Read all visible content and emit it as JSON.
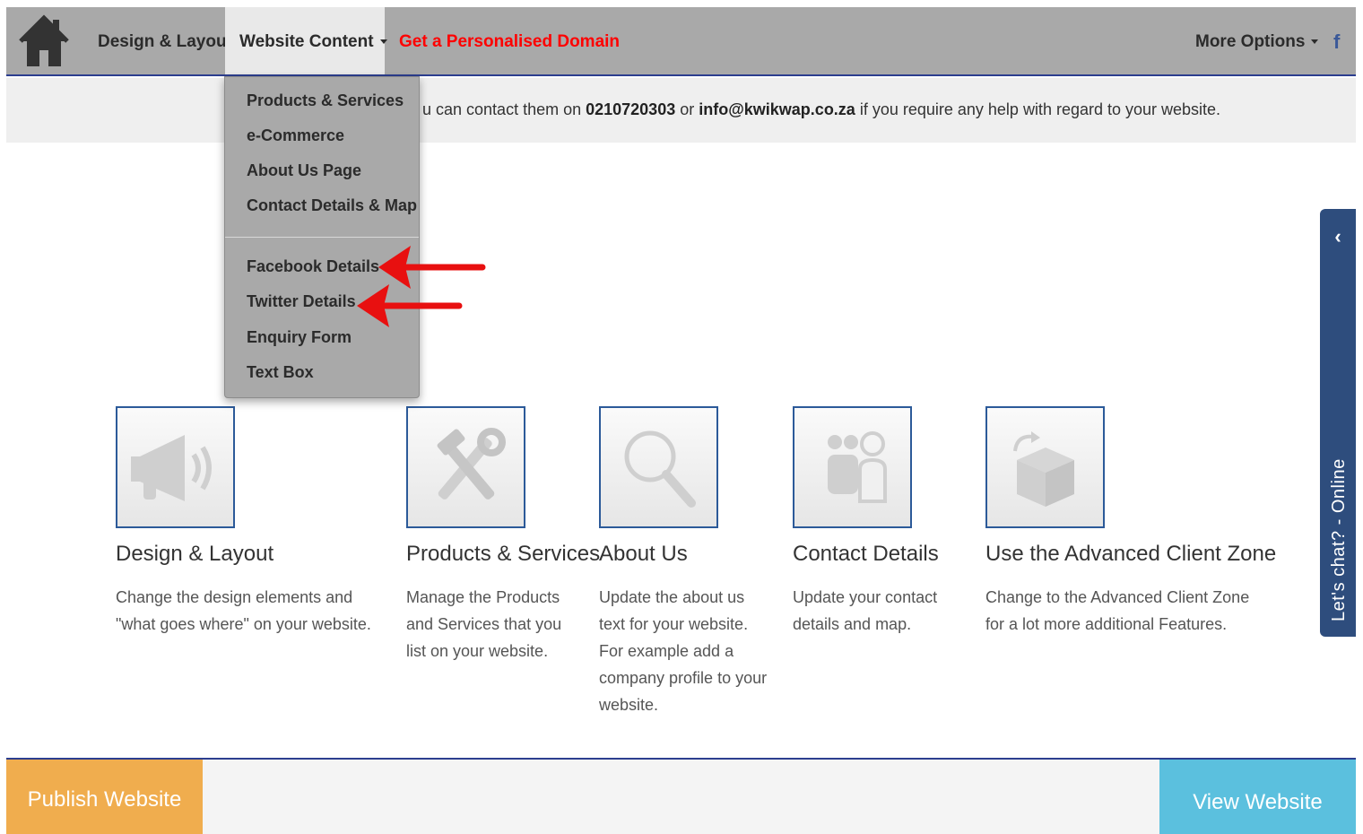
{
  "nav": {
    "home_icon": "home-icon",
    "design_layout": "Design & Layout",
    "website_content": "Website Content",
    "domain_link": "Get a Personalised Domain",
    "more_options": "More Options",
    "facebook_icon": "f"
  },
  "info": {
    "prefix": "u can contact them on ",
    "phone": "0210720303",
    "middle": " or ",
    "email": "info@kwikwap.co.za",
    "suffix": " if you require any help with regard to your website."
  },
  "dropdown": {
    "items": [
      "Products & Services",
      "e-Commerce",
      "About Us Page",
      "Contact Details & Map",
      "Facebook Details",
      "Twitter Details",
      "Enquiry Form",
      "Text Box"
    ]
  },
  "cards": [
    {
      "title": "Design & Layout",
      "desc": "Change the design elements and \"what goes where\" on your website.",
      "icon": "megaphone-icon"
    },
    {
      "title": "Products & Services",
      "desc": "Manage the Products and Services that you list on your website.",
      "icon": "tools-icon"
    },
    {
      "title": "About Us",
      "desc": "Update the about us text for your website. For example add a company profile to your website.",
      "icon": "magnifier-icon"
    },
    {
      "title": "Contact Details",
      "desc": "Update your contact details and map.",
      "icon": "people-icon"
    },
    {
      "title": "Use the Advanced Client Zone",
      "desc": "Change to the Advanced Client Zone for a lot more additional Features.",
      "icon": "box-icon"
    }
  ],
  "chat": {
    "chevron": "‹",
    "label": "Let's chat? - Online"
  },
  "footer": {
    "publish": "Publish Website",
    "view": "View Website"
  },
  "colors": {
    "nav_bg": "#a9a9a9",
    "domain_red": "#ff0000",
    "publish_orange": "#f0ad4e",
    "view_blue": "#5bc0de",
    "chat_blue": "#2e4d7d"
  }
}
